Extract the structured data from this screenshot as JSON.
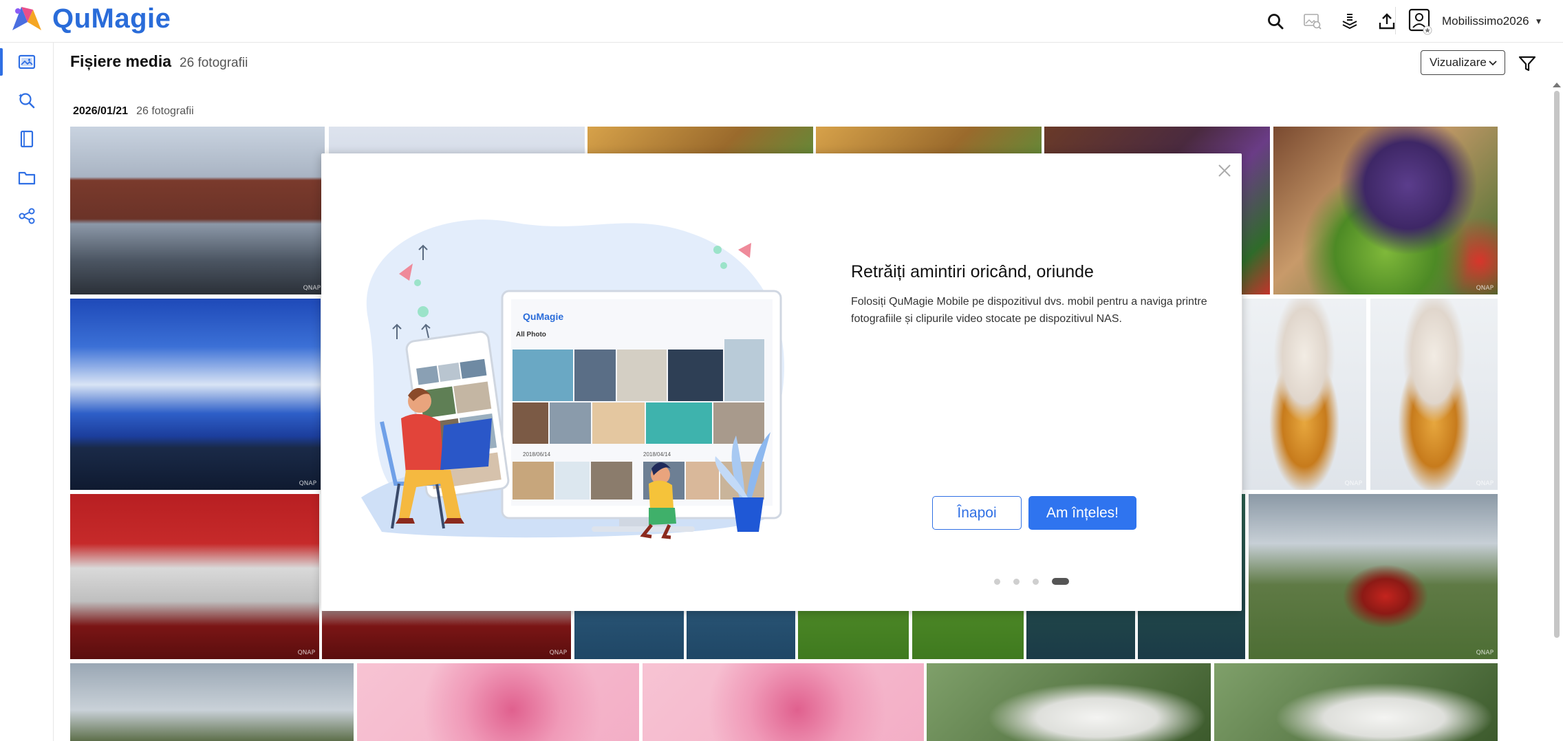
{
  "app": {
    "name": "QuMagie",
    "colors": {
      "brand": "#2a6cd9",
      "accent": "#2f74ef"
    }
  },
  "header": {
    "icons": [
      "search-icon",
      "image-search-icon",
      "background-tasks-icon",
      "upload-icon"
    ],
    "user": {
      "name": "Mobilissimo2026"
    }
  },
  "sidebar": {
    "items": [
      {
        "name": "photos",
        "icon": "photos-icon",
        "active": true
      },
      {
        "name": "smart-search",
        "icon": "smart-search-icon",
        "active": false
      },
      {
        "name": "albums",
        "icon": "albums-icon",
        "active": false
      },
      {
        "name": "folders",
        "icon": "folder-icon",
        "active": false
      },
      {
        "name": "share",
        "icon": "share-icon",
        "active": false
      }
    ]
  },
  "main": {
    "title": "Fișiere media",
    "count": "26 fotografii",
    "view_label": "Vizualizare",
    "group": {
      "date": "2026/01/21",
      "count": "26 fotografii"
    },
    "watermark": "QNAP"
  },
  "modal": {
    "heading": "Retrăiți amintiri oricând, oriunde",
    "body": "Folosiți QuMagie Mobile pe dispozitivul dvs. mobil pentru a naviga printre fotografiile și clipurile video stocate pe dispozitivul NAS.",
    "back_label": "Înapoi",
    "ok_label": "Am înțeles!",
    "pagination": {
      "total": 4,
      "current": 4
    },
    "illustration": {
      "app_name": "QuMagie",
      "header": "All Photo",
      "date1": "2018/06/14",
      "date2": "2018/04/14"
    }
  }
}
